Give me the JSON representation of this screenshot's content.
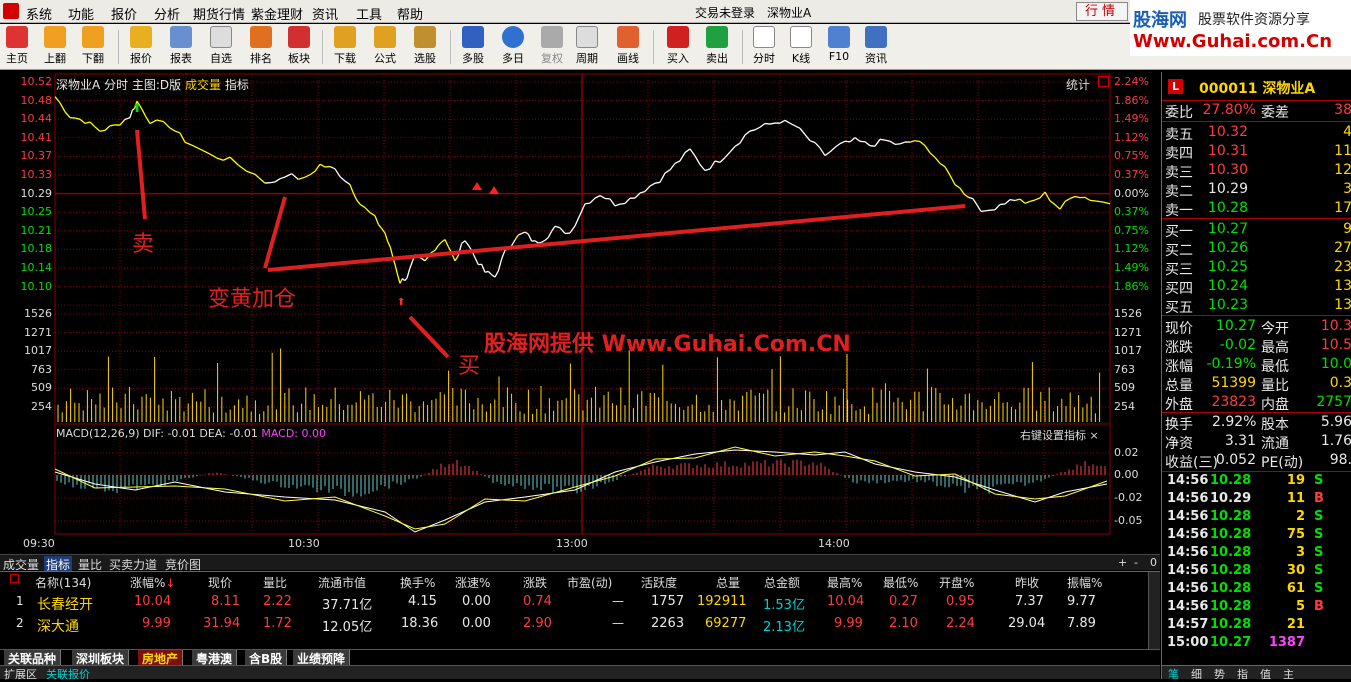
{
  "menubar": {
    "items": [
      "系统",
      "功能",
      "报价",
      "分析",
      "期货行情",
      "紫金理财",
      "资讯",
      "工具",
      "帮助"
    ],
    "login_status": "交易未登录",
    "stock_name": "深物业A",
    "quote_button": "行情"
  },
  "brand": {
    "name": "股海网",
    "slogan": "股票软件资源分享",
    "url": "Www.Guhai.com.Cn"
  },
  "toolbar": {
    "buttons": [
      "主页",
      "上翻",
      "下翻",
      "报价",
      "报表",
      "自选",
      "排名",
      "板块",
      "下载",
      "公式",
      "选股",
      "多股",
      "多日",
      "复权",
      "周期",
      "画线",
      "买入",
      "卖出",
      "分时",
      "K线",
      "F10",
      "资讯"
    ]
  },
  "chart": {
    "stock": "深物业A",
    "mode": "分时",
    "main_chart": "主图:D版",
    "volume_label": "成交量",
    "indicator_label": "指标",
    "stat_label": "统计",
    "price_left": [
      "10.52",
      "10.48",
      "10.44",
      "10.41",
      "10.37",
      "10.33",
      "10.29",
      "10.25",
      "10.21",
      "10.18",
      "10.14",
      "10.10"
    ],
    "price_right": [
      "2.24%",
      "1.86%",
      "1.49%",
      "1.12%",
      "0.75%",
      "0.37%",
      "0.00%",
      "0.37%",
      "0.75%",
      "1.12%",
      "1.49%",
      "1.86%"
    ],
    "volume_left": [
      "1526",
      "1271",
      "1017",
      "763",
      "509",
      "254"
    ],
    "volume_right": [
      "1526",
      "1271",
      "1017",
      "763",
      "509",
      "254"
    ],
    "macd_header": "MACD(12,26,9)",
    "macd_dif": "DIF: -0.01",
    "macd_dea": "DEA: -0.01",
    "macd_macd": "MACD: 0.00",
    "macd_settings": "右键设置指标",
    "macd_axis": [
      "0.02",
      "0.00",
      "-0.02",
      "-0.05"
    ],
    "time_labels": [
      "09:30",
      "10:30",
      "13:00",
      "14:00"
    ],
    "annotations": {
      "sell": "卖",
      "add": "变黄加仓",
      "buy": "买",
      "watermark": "股海网提供 Www.Guhai.Com.CN"
    }
  },
  "tabs": {
    "items": [
      "成交量",
      "指标",
      "量比",
      "买卖力道",
      "竞价图"
    ],
    "active": "指标",
    "controls": [
      "+",
      "-",
      "0"
    ]
  },
  "table": {
    "headers": [
      "名称(134)",
      "涨幅%",
      "现价",
      "量比",
      "流通市值",
      "换手%",
      "涨速%",
      "涨跌",
      "市盈(动)",
      "活跃度",
      "总量",
      "总金额",
      "最高%",
      "最低%",
      "开盘%",
      "昨收",
      "振幅%"
    ],
    "rows": [
      {
        "idx": "1",
        "name": "长春经开",
        "chg": "10.04",
        "price": "8.11",
        "vr": "2.22",
        "mcap": "37.71亿",
        "turn": "4.15",
        "speed": "0.00",
        "diff": "0.74",
        "pe": "—",
        "act": "1757",
        "vol": "192911",
        "amt": "1.53亿",
        "high": "10.04",
        "low": "0.27",
        "open": "0.95",
        "prev": "7.37",
        "amp": "9.77"
      },
      {
        "idx": "2",
        "name": "深大通",
        "chg": "9.99",
        "price": "31.94",
        "vr": "1.72",
        "mcap": "12.05亿",
        "turn": "18.36",
        "speed": "0.00",
        "diff": "2.90",
        "pe": "—",
        "act": "2263",
        "vol": "69277",
        "amt": "2.13亿",
        "high": "9.99",
        "low": "2.10",
        "open": "2.24",
        "prev": "29.04",
        "amp": "7.89"
      }
    ]
  },
  "sector_tabs": {
    "items": [
      "关联品种",
      "深圳板块",
      "房地产",
      "粤港澳",
      "含B股",
      "业绩预降"
    ],
    "active": "房地产"
  },
  "statusbar": {
    "items": [
      "扩展区",
      "关联报价"
    ],
    "active": "关联报价"
  },
  "rightpanel": {
    "code": "000011",
    "name": "深物业A",
    "wb_label": "委比",
    "wb_value": "27.80%",
    "wc_label": "委差",
    "wc_value": "38",
    "sells": [
      {
        "label": "卖五",
        "price": "10.32",
        "vol": "4"
      },
      {
        "label": "卖四",
        "price": "10.31",
        "vol": "11"
      },
      {
        "label": "卖三",
        "price": "10.30",
        "vol": "12"
      },
      {
        "label": "卖二",
        "price": "10.29",
        "vol": "3"
      },
      {
        "label": "卖一",
        "price": "10.28",
        "vol": "17"
      }
    ],
    "buys": [
      {
        "label": "买一",
        "price": "10.27",
        "vol": "9"
      },
      {
        "label": "买二",
        "price": "10.26",
        "vol": "27"
      },
      {
        "label": "买三",
        "price": "10.25",
        "vol": "23"
      },
      {
        "label": "买四",
        "price": "10.24",
        "vol": "13"
      },
      {
        "label": "买五",
        "price": "10.23",
        "vol": "13"
      }
    ],
    "stats": [
      {
        "l1": "现价",
        "v1": "10.27",
        "c1": "c-green",
        "l2": "今开",
        "v2": "10.3",
        "c2": "c-red"
      },
      {
        "l1": "涨跌",
        "v1": "-0.02",
        "c1": "c-green",
        "l2": "最高",
        "v2": "10.5",
        "c2": "c-red"
      },
      {
        "l1": "涨幅",
        "v1": "-0.19%",
        "c1": "c-green",
        "l2": "最低",
        "v2": "10.0",
        "c2": "c-green"
      },
      {
        "l1": "总量",
        "v1": "51399",
        "c1": "c-yellow",
        "l2": "量比",
        "v2": "0.3",
        "c2": "c-yellow"
      },
      {
        "l1": "外盘",
        "v1": "23823",
        "c1": "c-red",
        "l2": "内盘",
        "v2": "2757",
        "c2": "c-green"
      }
    ],
    "stats2": [
      {
        "l1": "换手",
        "v1": "2.92%",
        "l2": "股本",
        "v2": "5.96"
      },
      {
        "l1": "净资",
        "v1": "3.31",
        "l2": "流通",
        "v2": "1.76"
      },
      {
        "l1": "收益(三)",
        "v1": "0.052",
        "l2": "PE(动)",
        "v2": "98."
      }
    ],
    "ticks": [
      {
        "t": "14:56",
        "p": "10.28",
        "v": "19",
        "d": "S",
        "pc": "c-green",
        "vc": "c-yellow",
        "dc": "c-green"
      },
      {
        "t": "14:56",
        "p": "10.29",
        "v": "11",
        "d": "B",
        "pc": "c-white",
        "vc": "c-yellow",
        "dc": "c-red"
      },
      {
        "t": "14:56",
        "p": "10.28",
        "v": "2",
        "d": "S",
        "pc": "c-green",
        "vc": "c-yellow",
        "dc": "c-green"
      },
      {
        "t": "14:56",
        "p": "10.28",
        "v": "75",
        "d": "S",
        "pc": "c-green",
        "vc": "c-yellow",
        "dc": "c-green"
      },
      {
        "t": "14:56",
        "p": "10.28",
        "v": "3",
        "d": "S",
        "pc": "c-green",
        "vc": "c-yellow",
        "dc": "c-green"
      },
      {
        "t": "14:56",
        "p": "10.28",
        "v": "30",
        "d": "S",
        "pc": "c-green",
        "vc": "c-yellow",
        "dc": "c-green"
      },
      {
        "t": "14:56",
        "p": "10.28",
        "v": "61",
        "d": "S",
        "pc": "c-green",
        "vc": "c-yellow",
        "dc": "c-green"
      },
      {
        "t": "14:56",
        "p": "10.28",
        "v": "5",
        "d": "B",
        "pc": "c-green",
        "vc": "c-yellow",
        "dc": "c-red"
      },
      {
        "t": "14:57",
        "p": "10.28",
        "v": "21",
        "d": "",
        "pc": "c-green",
        "vc": "c-yellow",
        "dc": "c-white"
      },
      {
        "t": "15:00",
        "p": "10.27",
        "v": "1387",
        "d": "",
        "pc": "c-green",
        "vc": "c-magenta",
        "dc": "c-white"
      }
    ],
    "bottom_tabs": [
      "笔",
      "细",
      "势",
      "指",
      "值",
      "主"
    ],
    "bottom_active": "笔"
  },
  "colors": {
    "up": "#ff3c3c",
    "down": "#00e000",
    "price_line_white": "#ffffff",
    "price_line_yellow": "#ffff00",
    "grid": "#8b0000",
    "annotation": "#e02020"
  }
}
